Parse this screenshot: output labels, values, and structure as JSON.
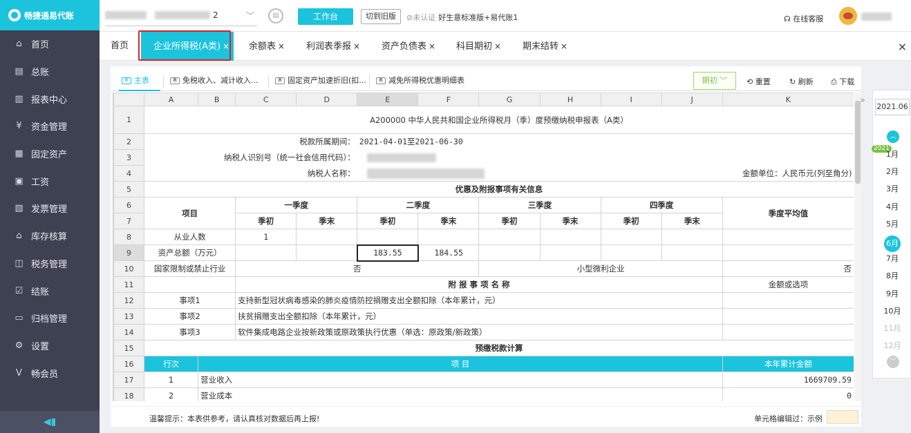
{
  "app": {
    "logo_text": "畅捷通易代账"
  },
  "sidebar": {
    "items": [
      {
        "label": "首页",
        "icon": "home-icon",
        "glyph": "⌂"
      },
      {
        "label": "总账",
        "icon": "ledger-icon",
        "glyph": "▤"
      },
      {
        "label": "报表中心",
        "icon": "chart-icon",
        "glyph": "▥"
      },
      {
        "label": "资金管理",
        "icon": "money-icon",
        "glyph": "¥"
      },
      {
        "label": "固定资产",
        "icon": "asset-icon",
        "glyph": "▦"
      },
      {
        "label": "工资",
        "icon": "salary-icon",
        "glyph": "▣"
      },
      {
        "label": "发票管理",
        "icon": "invoice-icon",
        "glyph": "▧"
      },
      {
        "label": "库存核算",
        "icon": "inventory-icon",
        "glyph": "⌂"
      },
      {
        "label": "税务管理",
        "icon": "tax-icon",
        "glyph": "◫"
      },
      {
        "label": "结账",
        "icon": "close-book-icon",
        "glyph": "☑"
      },
      {
        "label": "归档管理",
        "icon": "archive-icon",
        "glyph": "▭"
      },
      {
        "label": "设置",
        "icon": "gear-icon",
        "glyph": "⚙"
      },
      {
        "label": "畅会员",
        "icon": "vip-icon",
        "glyph": "V"
      }
    ],
    "collapse_glyph": "◀▮"
  },
  "topbar": {
    "account_suffix": "2",
    "workbench": "工作台",
    "switch_old": "切到旧版",
    "unauth": "⊘未认证",
    "edition": "好生意标准版+易代账1",
    "service": "在线客服"
  },
  "tabs": [
    {
      "label": "首页",
      "closable": false
    },
    {
      "label": "企业所得税(A类)",
      "closable": true
    },
    {
      "label": "余额表",
      "closable": true
    },
    {
      "label": "利润表季报",
      "closable": true
    },
    {
      "label": "资产负债表",
      "closable": true
    },
    {
      "label": "科目期初",
      "closable": true
    },
    {
      "label": "期末结转",
      "closable": true
    }
  ],
  "tab_close": "×",
  "subtabs": [
    "主表",
    "免税收入、减计收入...",
    "固定资产加速折旧(扣...",
    "减免所得税优惠明细表"
  ],
  "toolbar": {
    "period": "期初 ﹀",
    "reset": "⟲ 重置",
    "refresh": "↻ 刷新",
    "download": "⎙ 下载"
  },
  "sheet": {
    "cols": [
      "",
      "A",
      "B",
      "C",
      "D",
      "E",
      "F",
      "G",
      "H",
      "I",
      "J",
      "K"
    ],
    "title": "A200000 中华人民共和国企业所得税月（季）度预缴纳税申报表（A类）",
    "period_label": "税款所属期间：",
    "period_value": "2021-04-01至2021-06-30",
    "taxid_label": "纳税人识别号（统一社会信用代码）：",
    "name_label": "纳税人名称：",
    "unit": "金额单位：人民币元(列至角分)",
    "r5": "优惠及附报事项有关信息",
    "item": "项目",
    "q1": "一季度",
    "q2": "二季度",
    "q3": "三季度",
    "q4": "四季度",
    "qavg": "季度平均值",
    "start": "季初",
    "end": "季末",
    "r8_label": "从业人数",
    "r8_c": "1",
    "r9_label": "资产总额（万元）",
    "r9_e": "183.55",
    "r9_f": "184.55",
    "r10_label": "国家限制或禁止行业",
    "r10_v": "否",
    "r10_mid": "小型微利企业",
    "r10_k": "否",
    "r11_title": "附 报 事 项 名 称",
    "r11_k": "金额或选项",
    "r12_a": "事项1",
    "r12_c": "支持新型冠状病毒感染的肺炎疫情防控捐赠支出全额扣除（本年累计，元）",
    "r13_a": "事项2",
    "r13_c": "扶贫捐赠支出全额扣除（本年累计，元）",
    "r14_a": "事项3",
    "r14_c": "软件集成电路企业按新政策或原政策执行优惠（单选：原政策/新政策）",
    "r15": "预缴税款计算",
    "r16_a": "行次",
    "r16_mid": "项 目",
    "r16_k": "本年累计金额",
    "r17_a": "1",
    "r17_b": "营业收入",
    "r17_k": "1669709.59",
    "r18_a": "2",
    "r18_b": "营业成本",
    "r18_k": "0"
  },
  "footer": {
    "tip": "温馨提示：本表供参考，请认真核对数据后再上报!",
    "edited": "单元格编辑过：示例"
  },
  "month_panel": {
    "current": "2021.06",
    "year_badge": "2021",
    "months": [
      "1月",
      "2月",
      "3月",
      "4月",
      "5月",
      "6月",
      "7月",
      "8月",
      "9月",
      "10月",
      "11月",
      "12月"
    ],
    "selected": 5,
    "disabled_from": 10
  }
}
